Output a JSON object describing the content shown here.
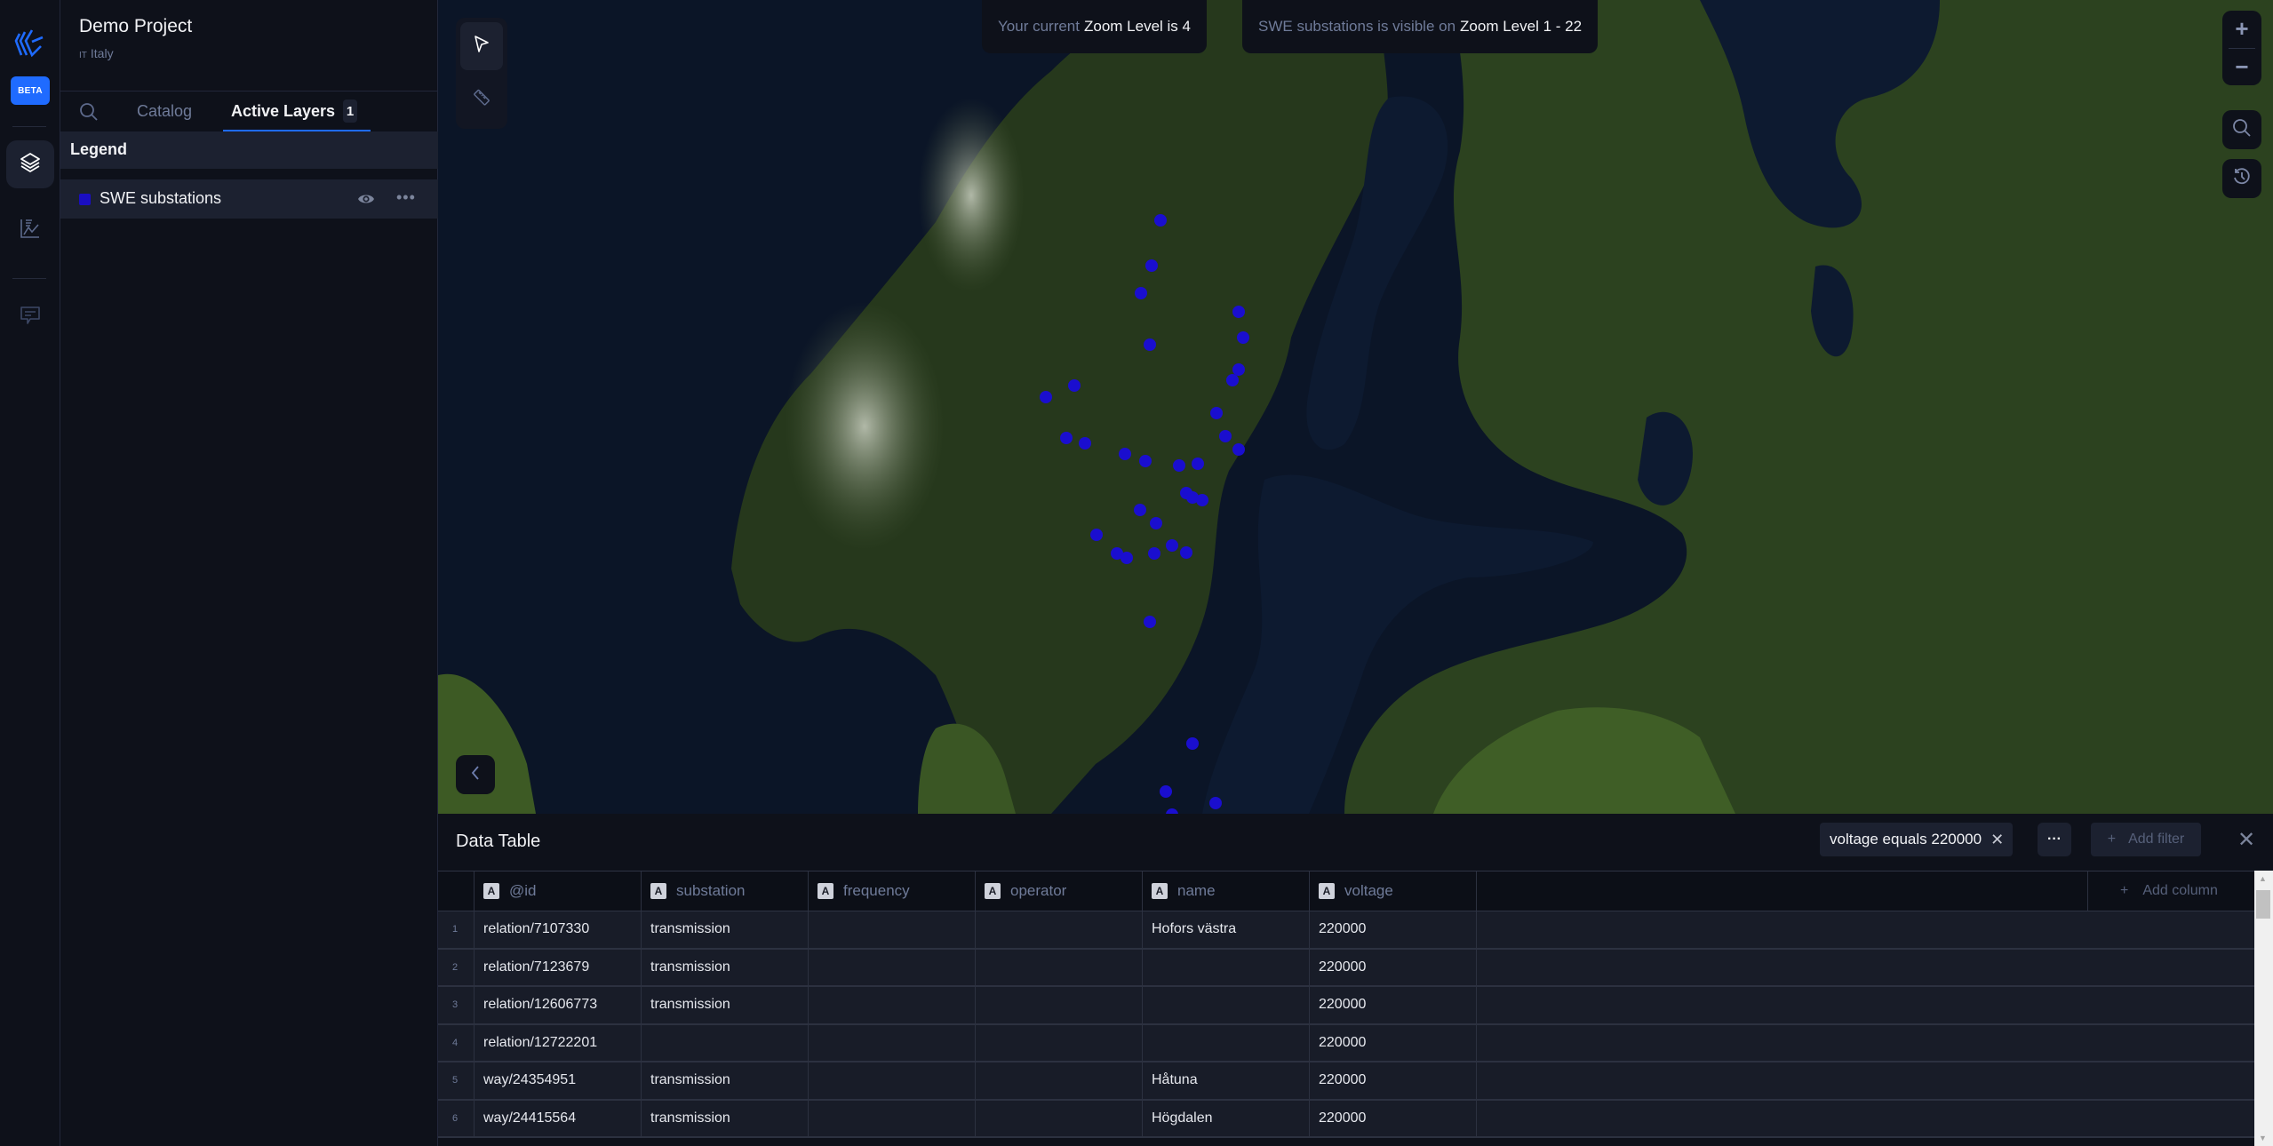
{
  "app": {
    "beta_label": "BETA",
    "rail_items": [
      {
        "icon": "layers-icon",
        "active": true
      },
      {
        "icon": "chart-icon",
        "active": false
      },
      {
        "icon": "comment-icon",
        "active": false
      }
    ]
  },
  "project": {
    "title": "Demo Project",
    "country_code": "IT",
    "country": "Italy"
  },
  "tabs": {
    "catalog": "Catalog",
    "active_layers": "Active Layers",
    "active_layers_count": "1"
  },
  "legend": {
    "title": "Legend",
    "layers": [
      {
        "name": "SWE substations",
        "color": "#1a0ec2",
        "visible": true
      }
    ]
  },
  "map": {
    "zoom_info": {
      "prefix": "Your current",
      "value": "Zoom Level is 4"
    },
    "visibility_info": {
      "prefix": "SWE substations is visible on",
      "value": "Zoom Level 1 - 22"
    },
    "zoom_in": "+",
    "zoom_out": "−",
    "point_color": "#1a0ecf",
    "basemap": "satellite"
  },
  "data_table": {
    "title": "Data Table",
    "filter_chip": "voltage equals 220000",
    "more_label": "···",
    "add_filter_label": "Add filter",
    "add_column_label": "Add column",
    "columns": [
      "@id",
      "substation",
      "frequency",
      "operator",
      "name",
      "voltage"
    ],
    "column_type_badge": "A",
    "rows": [
      {
        "n": "1",
        "id": "relation/7107330",
        "substation": "transmission",
        "frequency": "",
        "operator": "",
        "name": "Hofors västra",
        "voltage": "220000"
      },
      {
        "n": "2",
        "id": "relation/7123679",
        "substation": "transmission",
        "frequency": "",
        "operator": "",
        "name": "",
        "voltage": "220000"
      },
      {
        "n": "3",
        "id": "relation/12606773",
        "substation": "transmission",
        "frequency": "",
        "operator": "",
        "name": "",
        "voltage": "220000"
      },
      {
        "n": "4",
        "id": "relation/12722201",
        "substation": "",
        "frequency": "",
        "operator": "",
        "name": "",
        "voltage": "220000"
      },
      {
        "n": "5",
        "id": "way/24354951",
        "substation": "transmission",
        "frequency": "",
        "operator": "",
        "name": "Håtuna",
        "voltage": "220000"
      },
      {
        "n": "6",
        "id": "way/24415564",
        "substation": "transmission",
        "frequency": "",
        "operator": "",
        "name": "Högdalen",
        "voltage": "220000"
      }
    ]
  }
}
